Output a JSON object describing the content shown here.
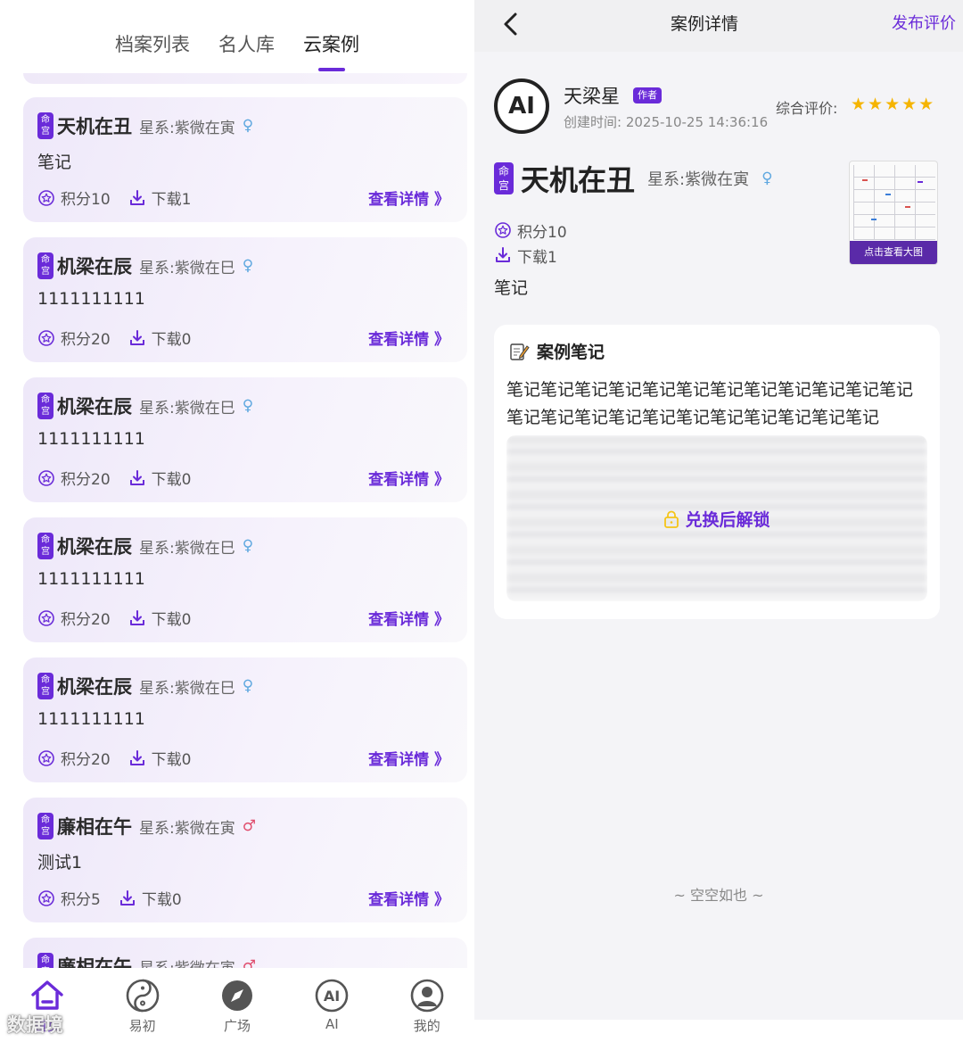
{
  "left": {
    "tabs": [
      {
        "label": "档案列表",
        "active": false
      },
      {
        "label": "名人库",
        "active": false
      },
      {
        "label": "云案例",
        "active": true
      }
    ],
    "badge": [
      "命",
      "宫"
    ],
    "cards": [
      {
        "name": "天机在丑",
        "system": "星系:紫微在寅",
        "gender": "♀",
        "note": "笔记",
        "points": "积分10",
        "downloads": "下载1",
        "detail": "查看详情 》"
      },
      {
        "name": "机梁在辰",
        "system": "星系:紫微在巳",
        "gender": "♀",
        "note": "1111111111",
        "points": "积分20",
        "downloads": "下载0",
        "detail": "查看详情 》"
      },
      {
        "name": "机梁在辰",
        "system": "星系:紫微在巳",
        "gender": "♀",
        "note": "1111111111",
        "points": "积分20",
        "downloads": "下载0",
        "detail": "查看详情 》"
      },
      {
        "name": "机梁在辰",
        "system": "星系:紫微在巳",
        "gender": "♀",
        "note": "1111111111",
        "points": "积分20",
        "downloads": "下载0",
        "detail": "查看详情 》"
      },
      {
        "name": "机梁在辰",
        "system": "星系:紫微在巳",
        "gender": "♀",
        "note": "1111111111",
        "points": "积分20",
        "downloads": "下载0",
        "detail": "查看详情 》"
      },
      {
        "name": "廉相在午",
        "system": "星系:紫微在寅",
        "gender": "♂",
        "note": "测试1",
        "points": "积分5",
        "downloads": "下载0",
        "detail": "查看详情 》"
      },
      {
        "name": "廉相在午",
        "system": "星系:紫微在寅",
        "gender": "♂",
        "note": "",
        "points": "",
        "downloads": "",
        "detail": ""
      }
    ],
    "nav": [
      {
        "label": "首页",
        "icon": "home-icon",
        "active": true
      },
      {
        "label": "易初",
        "icon": "yin-yang-icon",
        "active": false
      },
      {
        "label": "广场",
        "icon": "compass-icon",
        "active": false
      },
      {
        "label": "AI",
        "icon": "ai-icon",
        "active": false
      },
      {
        "label": "我的",
        "icon": "user-icon",
        "active": false
      }
    ],
    "watermark": "数据境"
  },
  "right": {
    "title": "案例详情",
    "publish": "发布评价",
    "avatar_text": "AI",
    "author_name": "天梁星",
    "author_tag": "作者",
    "created": "创建时间: 2025-10-25 14:36:16",
    "rating_label": "综合评价:",
    "stars": "★★★★★",
    "rating_value": 5,
    "case_name": "天机在丑",
    "case_system": "星系:紫微在寅",
    "case_gender": "♀",
    "points": "积分10",
    "downloads": "下载1",
    "note": "笔记",
    "thumb_button": "点击查看大图",
    "note_box_title": "案例笔记",
    "note_text": "笔记笔记笔记笔记笔记笔记笔记笔记笔记笔记笔记笔记笔记笔记笔记笔记笔记笔记笔记笔记笔记笔记笔记",
    "unlock_label": "兑换后解锁",
    "empty": "~ 空空如也 ~"
  },
  "colors": {
    "accent": "#6a2bd9",
    "star": "#f5b400",
    "female": "#5fa8e0",
    "male": "#e04d6d"
  }
}
